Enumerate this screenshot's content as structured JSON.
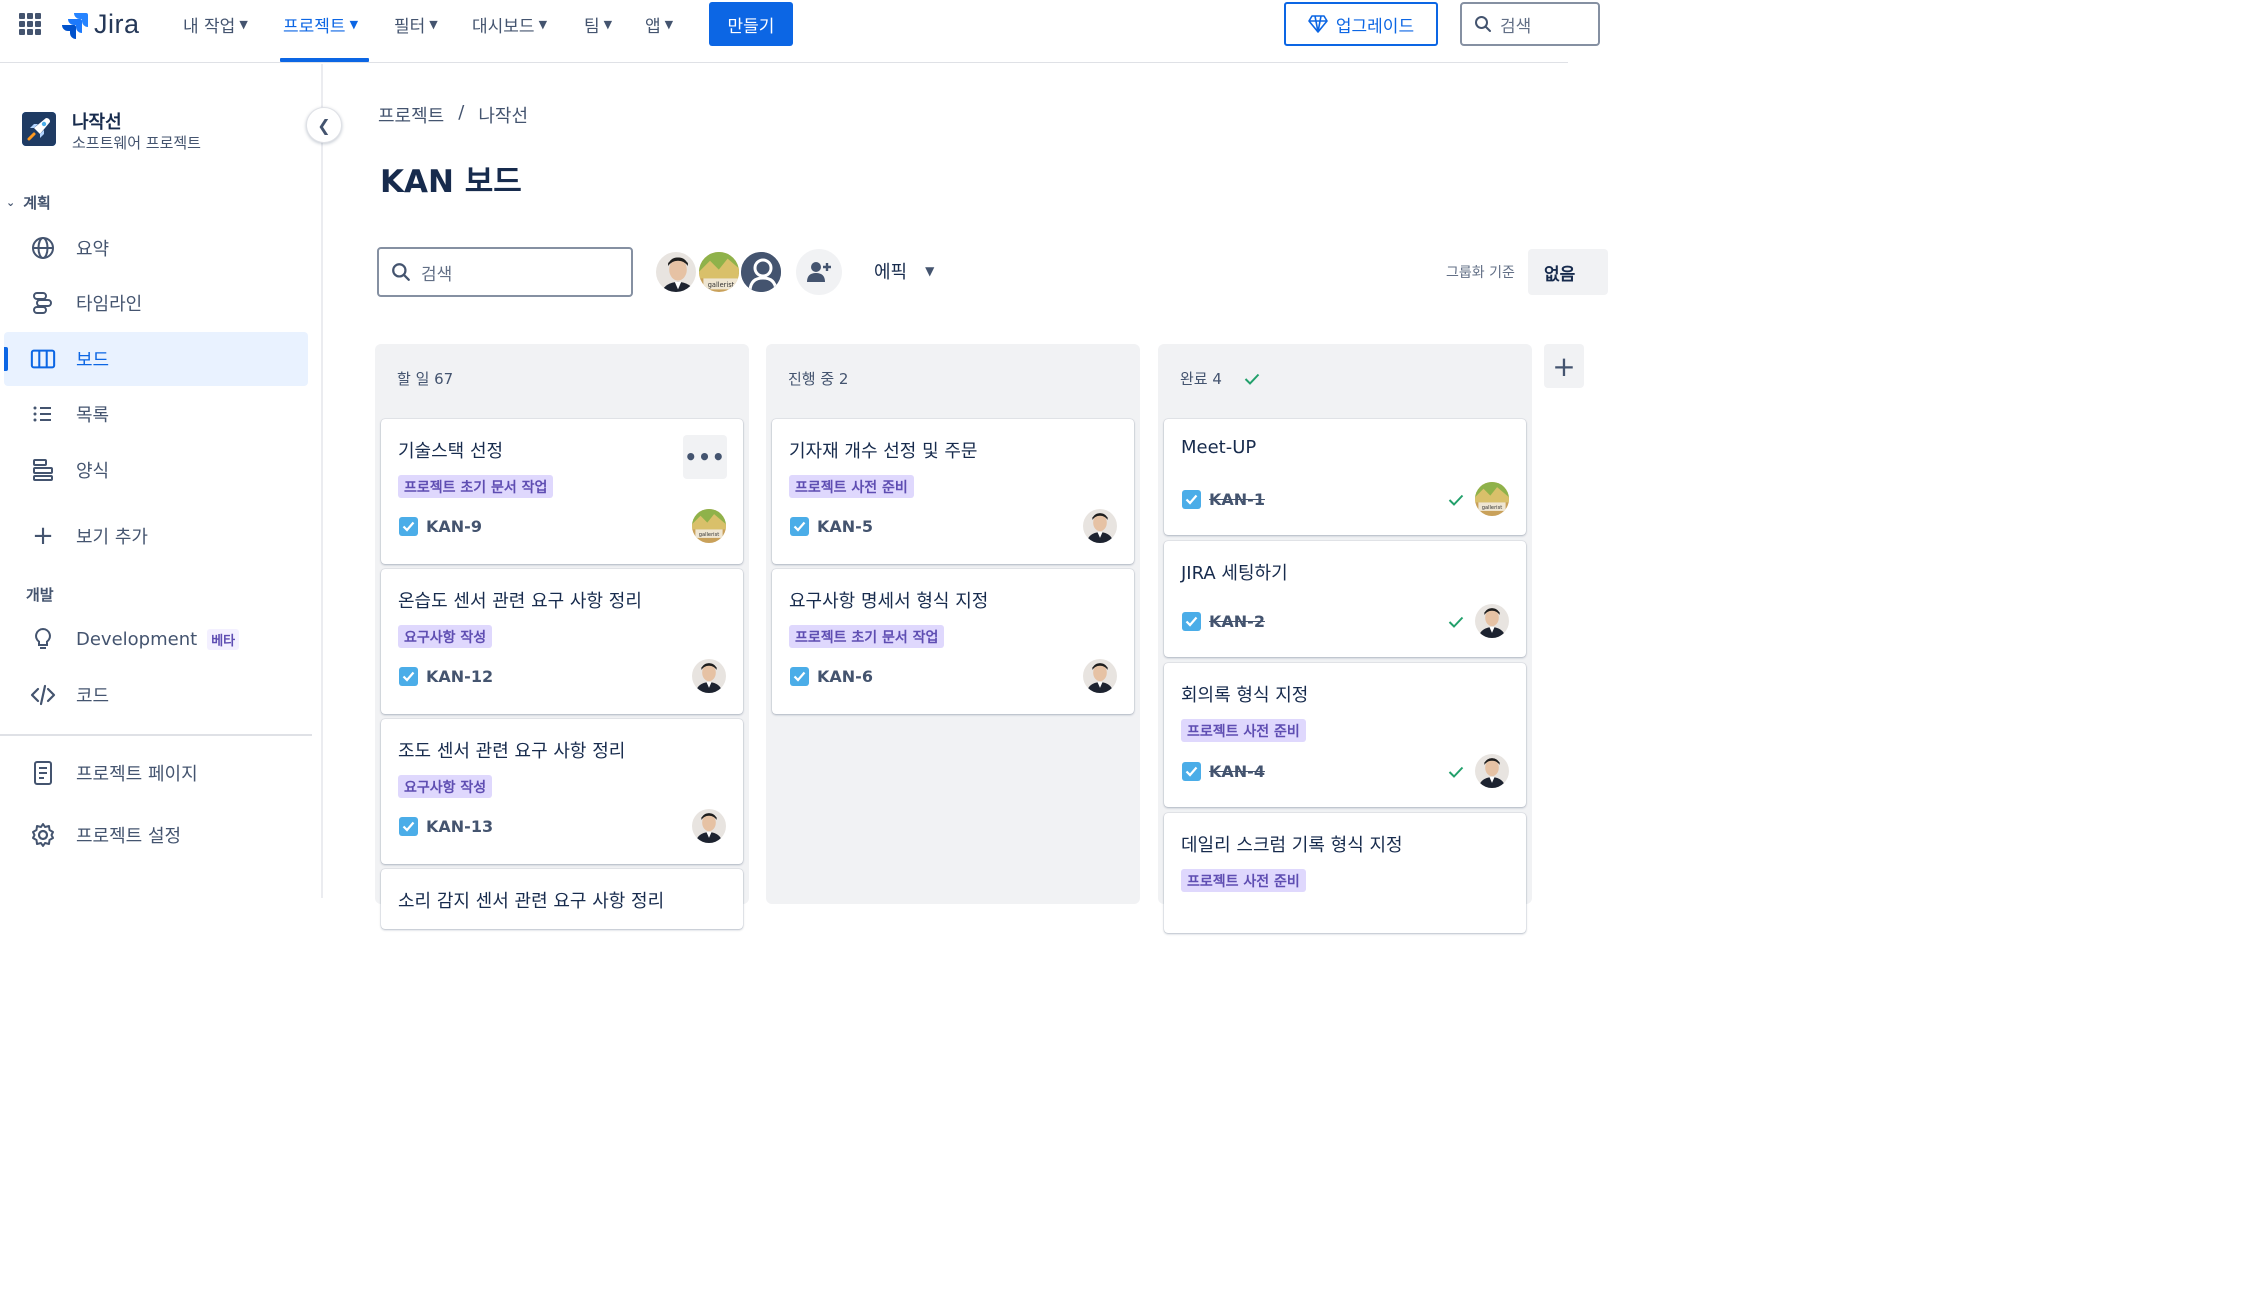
{
  "topnav": {
    "logo": "Jira",
    "items": [
      "내 작업",
      "프로젝트",
      "필터",
      "대시보드",
      "팀",
      "앱"
    ],
    "create_label": "만들기",
    "upgrade_label": "업그레이드",
    "search_placeholder": "검색",
    "accent": "#0c66e4"
  },
  "sidebar": {
    "project_name": "나작선",
    "project_type": "소프트웨어 프로젝트",
    "planning_label": "계획",
    "planning_items": [
      "요약",
      "타임라인",
      "보드",
      "목록",
      "양식"
    ],
    "add_view_label": "보기 추가",
    "dev_label": "개발",
    "dev_items": [
      "Development",
      "코드"
    ],
    "beta_label": "베타",
    "bottom_items": [
      "프로젝트 페이지",
      "프로젝트 설정"
    ]
  },
  "main": {
    "breadcrumb": [
      "프로젝트",
      "/",
      "나작선"
    ],
    "title": "KAN 보드",
    "search_placeholder": "검색",
    "epic_label": "에픽",
    "group_label": "그룹화 기준",
    "group_value": "없음"
  },
  "columns": [
    {
      "title": "할 일 67",
      "cards": [
        {
          "title": "기술스택 선정",
          "epic": "프로젝트 초기 문서 작업",
          "key": "KAN-9",
          "avatar": "gallerist"
        },
        {
          "title": "온습도 센서 관련 요구 사항 정리",
          "epic": "요구사항 작성",
          "key": "KAN-12",
          "avatar": "man"
        },
        {
          "title": "조도 센서 관련 요구 사항 정리",
          "epic": "요구사항 작성",
          "key": "KAN-13",
          "avatar": "man"
        },
        {
          "title": "소리 감지 센서 관련 요구 사항 정리",
          "epic": "",
          "key": "",
          "avatar": ""
        }
      ]
    },
    {
      "title": "진행 중 2",
      "cards": [
        {
          "title": "기자재 개수 선정 및 주문",
          "epic": "프로젝트 사전 준비",
          "key": "KAN-5",
          "avatar": "man"
        },
        {
          "title": "요구사항 명세서 형식 지정",
          "epic": "프로젝트 초기 문서 작업",
          "key": "KAN-6",
          "avatar": "man"
        }
      ]
    },
    {
      "title": "완료 4",
      "cards": [
        {
          "title": "Meet-UP",
          "epic": "",
          "key": "KAN-1",
          "avatar": "gallerist"
        },
        {
          "title": "JIRA 세팅하기",
          "epic": "",
          "key": "KAN-2",
          "avatar": "man"
        },
        {
          "title": "회의록 형식 지정",
          "epic": "프로젝트 사전 준비",
          "key": "KAN-4",
          "avatar": "man"
        },
        {
          "title": "데일리 스크럼 기록 형식 지정",
          "epic": "프로젝트 사전 준비",
          "key": "",
          "avatar": ""
        }
      ]
    }
  ]
}
